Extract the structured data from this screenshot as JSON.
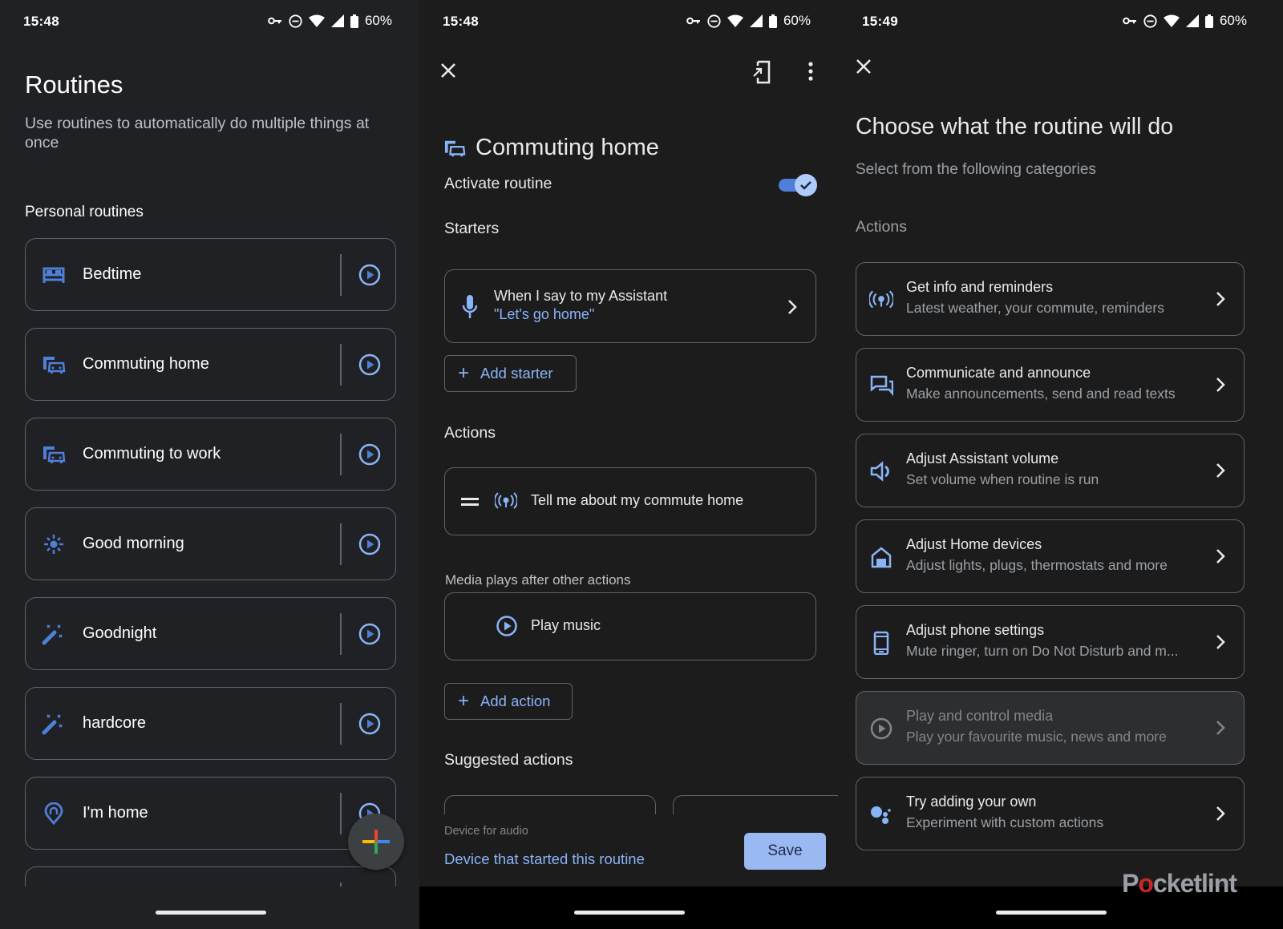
{
  "colors": {
    "accent": "#8ab4f8",
    "icon_blue": "#4f7fd8",
    "save_bg": "#9ab9f2",
    "panel_left_bg": "#202124",
    "panel_bg": "#1c1c1c",
    "border": "#5f6368"
  },
  "screens": [
    {
      "status": {
        "time": "15:48",
        "battery": "60%",
        "icons": [
          "vpn-key-icon",
          "dnd-icon",
          "wifi-icon",
          "cell-signal-icon",
          "battery-icon"
        ]
      },
      "title": "Routines",
      "subtitle": "Use routines to automatically do multiple things at once",
      "section": "Personal routines",
      "routines": [
        {
          "label": "Bedtime",
          "icon": "bed-icon"
        },
        {
          "label": "Commuting home",
          "icon": "commute-icon"
        },
        {
          "label": "Commuting to work",
          "icon": "commute-icon"
        },
        {
          "label": "Good morning",
          "icon": "sun-icon"
        },
        {
          "label": "Goodnight",
          "icon": "magic-wand-icon"
        },
        {
          "label": "hardcore",
          "icon": "magic-wand-icon"
        },
        {
          "label": "I'm home",
          "icon": "location-home-icon"
        }
      ],
      "fab_icon": "add-icon"
    },
    {
      "status": {
        "time": "15:48",
        "battery": "60%"
      },
      "toolbar": {
        "close_icon": "close-icon",
        "add_to_home_icon": "add-to-home-screen-icon",
        "more_icon": "more-vert-icon"
      },
      "title": "Commuting home",
      "activate_label": "Activate routine",
      "activate_on": true,
      "starters_heading": "Starters",
      "starter": {
        "title": "When I say to my Assistant",
        "phrase": "\"Let's go home\""
      },
      "add_starter": "Add starter",
      "actions_heading": "Actions",
      "action": "Tell me about my commute home",
      "media_note": "Media plays after other actions",
      "media_action": "Play music",
      "add_action": "Add action",
      "suggested_heading": "Suggested actions",
      "device_label": "Device for audio",
      "device_value": "Device that started this routine",
      "save": "Save"
    },
    {
      "status": {
        "time": "15:49",
        "battery": "60%"
      },
      "title": "Choose what the routine will do",
      "subtitle": "Select from the following categories",
      "section": "Actions",
      "categories": [
        {
          "title": "Get info and reminders",
          "desc": "Latest weather, your commute, reminders",
          "icon": "broadcast-icon",
          "disabled": false
        },
        {
          "title": "Communicate and announce",
          "desc": "Make announcements, send and read texts",
          "icon": "chat-icon",
          "disabled": false
        },
        {
          "title": "Adjust Assistant volume",
          "desc": "Set volume when routine is run",
          "icon": "volume-icon",
          "disabled": false
        },
        {
          "title": "Adjust Home devices",
          "desc": "Adjust lights, plugs, thermostats and more",
          "icon": "home-icon",
          "disabled": false
        },
        {
          "title": "Adjust phone settings",
          "desc": "Mute ringer, turn on Do Not Disturb and m...",
          "icon": "phone-icon",
          "disabled": false
        },
        {
          "title": "Play and control media",
          "desc": "Play your favourite music, news and more",
          "icon": "play-circle-icon",
          "disabled": true
        },
        {
          "title": "Try adding your own",
          "desc": "Experiment with custom actions",
          "icon": "assistant-dots-icon",
          "disabled": false
        }
      ],
      "watermark": {
        "pre": "P",
        "o": "o",
        "post": "cketlint"
      }
    }
  ]
}
